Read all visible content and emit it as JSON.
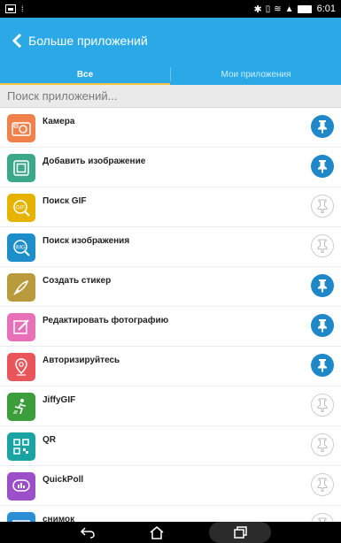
{
  "status_bar": {
    "time": "6:01",
    "icons": [
      "image-icon",
      "sim-icon",
      "bluetooth-icon",
      "vibrate-icon",
      "wifi-icon",
      "signal-icon",
      "battery-icon"
    ]
  },
  "header": {
    "title": "Больше приложений",
    "color": "#2aa9e6"
  },
  "tabs": [
    {
      "label": "Все",
      "active": true
    },
    {
      "label": "Мои приложения",
      "active": false
    }
  ],
  "search": {
    "placeholder": "Поиск приложений..."
  },
  "apps": [
    {
      "name": "Камера",
      "icon": "camera-icon",
      "icon_bg": "#f2804a",
      "pinned": true
    },
    {
      "name": "Добавить изображение",
      "icon": "add-image-icon",
      "icon_bg": "#3aa889",
      "pinned": true
    },
    {
      "name": "Поиск GIF",
      "icon": "gif-search-icon",
      "icon_bg": "#e6b400",
      "pinned": false
    },
    {
      "name": "Поиск изображения",
      "icon": "image-search-icon",
      "icon_bg": "#1d8ec9",
      "pinned": false
    },
    {
      "name": "Создать стикер",
      "icon": "sticker-icon",
      "icon_bg": "#b99a3d",
      "pinned": true
    },
    {
      "name": "Редактировать фотографию",
      "icon": "edit-photo-icon",
      "icon_bg": "#e870b8",
      "pinned": true
    },
    {
      "name": "Авторизируйтесь",
      "icon": "location-icon",
      "icon_bg": "#e8565c",
      "pinned": true
    },
    {
      "name": "JiffyGIF",
      "icon": "jiffygif-icon",
      "icon_bg": "#3c9e3a",
      "pinned": false
    },
    {
      "name": "QR",
      "icon": "qr-icon",
      "icon_bg": "#1aa3a3",
      "pinned": false
    },
    {
      "name": "QuickPoll",
      "icon": "quickpoll-icon",
      "icon_bg": "#9b4fc8",
      "pinned": false
    },
    {
      "name": "снимок",
      "icon": "snapshot-icon",
      "icon_bg": "#2a8fd4",
      "pinned": false
    }
  ],
  "navbar": {
    "buttons": [
      "back-icon",
      "home-icon",
      "recent-apps-icon"
    ]
  }
}
